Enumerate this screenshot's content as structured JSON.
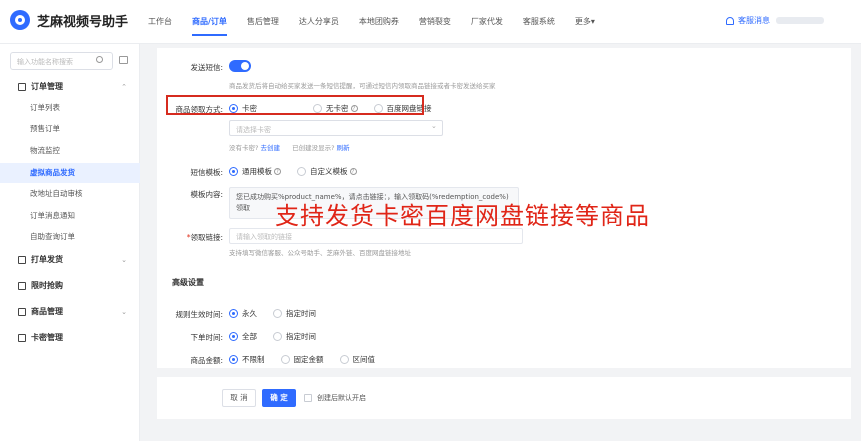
{
  "app": {
    "title": "芝麻视频号助手"
  },
  "nav": [
    "工作台",
    "商品/订单",
    "售后管理",
    "达人分享员",
    "本地团购券",
    "营销裂变",
    "厂家代发",
    "客服系统",
    "更多▾"
  ],
  "header": {
    "message_label": "客服消息"
  },
  "sidebar": {
    "search_placeholder": "输入功能名称搜索",
    "groups": [
      {
        "label": "订单管理",
        "chevron": "⌃"
      },
      {
        "label": "打单发货",
        "chevron": "⌄"
      },
      {
        "label": "限时抢购",
        "chevron": ""
      },
      {
        "label": "商品管理",
        "chevron": "⌄"
      },
      {
        "label": "卡密管理",
        "chevron": ""
      }
    ],
    "order_items": [
      "订单列表",
      "预售订单",
      "物流监控",
      "虚拟商品发货",
      "改地址自动审核",
      "订单消息通知",
      "自助查询订单"
    ]
  },
  "form": {
    "sms_label": "发送短信:",
    "sms_hint": "商品发货后将自动给买家发送一条短信提醒，可通过短信内领取商品链接或者卡密发送给买家",
    "pickup_label": "商品领取方式:",
    "pickup_options": [
      "卡密",
      "无卡密",
      "百度网盘链接"
    ],
    "card_select_placeholder": "请选择卡密",
    "no_card_text": "没有卡密?",
    "create_link": "去创建",
    "created_text": "已创建没显示?",
    "refresh_link": "刷新",
    "sms_template_label": "短信模板:",
    "template_options": [
      "通用模板",
      "自定义模板"
    ],
    "template_content_label": "模板内容:",
    "template_content": "您已成功购买%product_name%，请点击链接：，输入领取码(%redemption_code%)领取",
    "receive_link_label": "领取链接:",
    "receive_link_placeholder": "请输入领取的链接",
    "receive_link_hint": "支持填写微信客服、公众号助手、芝麻外链、百度网盘链接地址",
    "advanced_title": "高级设置",
    "rule_time_label": "规则生效时间:",
    "rule_time_options": [
      "永久",
      "指定时间"
    ],
    "order_time_label": "下单时间:",
    "order_time_options": [
      "全部",
      "指定时间"
    ],
    "amount_label": "商品金额:",
    "amount_options": [
      "不限制",
      "固定金额",
      "区间值"
    ]
  },
  "overlay_text": "支持发货卡密百度网盘链接等商品",
  "footer": {
    "cancel": "取 消",
    "confirm": "确 定",
    "checkbox_label": "创建后默认开启"
  }
}
